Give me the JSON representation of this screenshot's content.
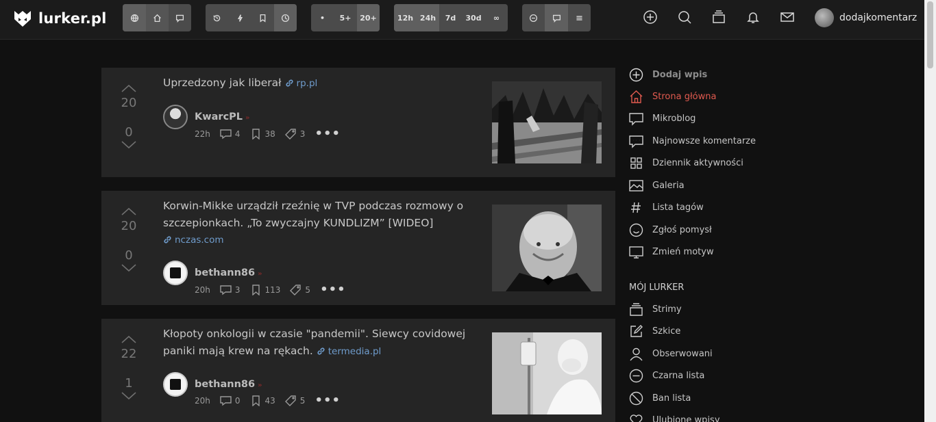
{
  "brand": {
    "name": "lurker.pl"
  },
  "user": {
    "name": "dodajkomentarz"
  },
  "filters": {
    "sizes": [
      "•",
      "5+",
      "20+"
    ],
    "times": [
      "12h",
      "24h",
      "7d",
      "30d",
      "∞"
    ]
  },
  "posts": [
    {
      "title": "Uprzedzony jak liberał",
      "domain": "rp.pl",
      "upvotes": "20",
      "downvotes": "0",
      "author": "KwarcPL",
      "time": "22h",
      "comments": "4",
      "saves": "38",
      "tags": "3"
    },
    {
      "title": "Korwin-Mikke urządził rzeźnię w TVP podczas rozmowy o szczepionkach. „To zwyczajny KUNDLIZM” [WIDEO]",
      "domain": "nczas.com",
      "upvotes": "20",
      "downvotes": "0",
      "author": "bethann86",
      "time": "20h",
      "comments": "3",
      "saves": "113",
      "tags": "5"
    },
    {
      "title": "Kłopoty onkologii w czasie \"pandemii\". Siewcy covidowej paniki mają krew na rękach.",
      "domain": "termedia.pl",
      "upvotes": "22",
      "downvotes": "1",
      "author": "bethann86",
      "time": "20h",
      "comments": "0",
      "saves": "43",
      "tags": "5"
    }
  ],
  "sidebar": {
    "items": [
      "Dodaj wpis",
      "Strona główna",
      "Mikroblog",
      "Najnowsze komentarze",
      "Dziennik aktywności",
      "Galeria",
      "Lista tagów",
      "Zgłoś pomysł",
      "Zmień motyw"
    ],
    "section_title": "MÓJ LURKER",
    "my_items": [
      "Strimy",
      "Szkice",
      "Obserwowani",
      "Czarna lista",
      "Ban lista",
      "Ulubione wpisy"
    ]
  },
  "colors": {
    "background": "#111111",
    "card": "#252525",
    "accent_red": "#e05a4f",
    "link_blue": "#6f9ccc"
  }
}
